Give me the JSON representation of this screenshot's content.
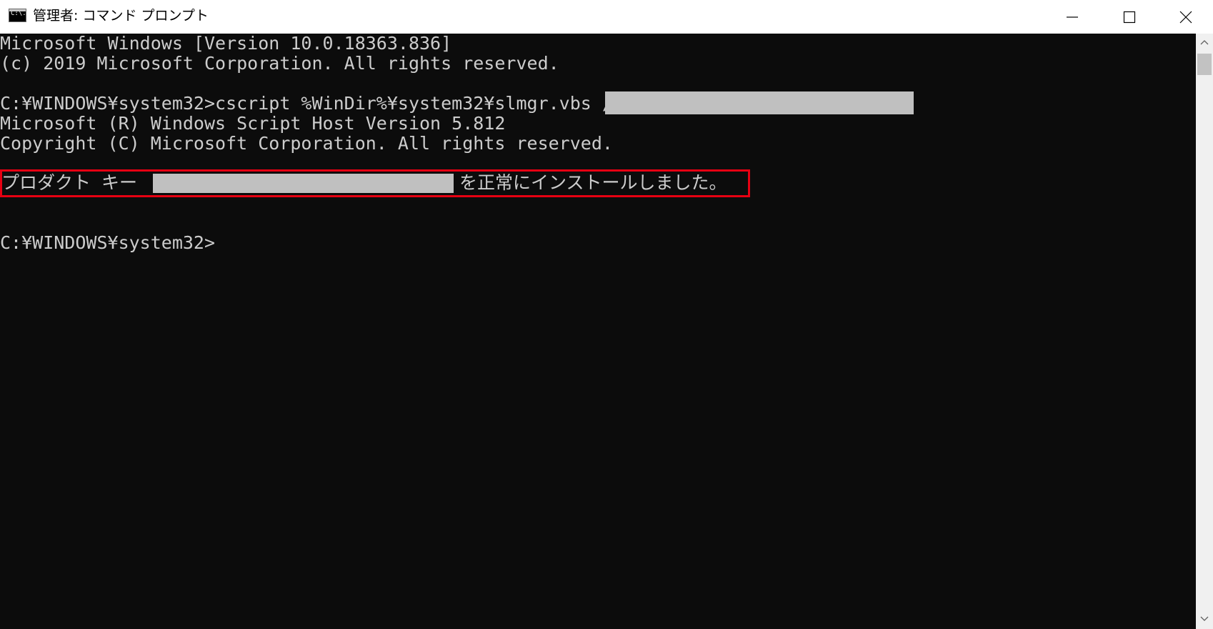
{
  "window": {
    "title": "管理者: コマンド プロンプト",
    "icon_text": "C:\\."
  },
  "controls": {
    "minimize_icon": "minimize-icon",
    "maximize_icon": "maximize-icon",
    "close_icon": "close-icon"
  },
  "console": {
    "lines": [
      "Microsoft Windows [Version 10.0.18363.836]",
      "(c) 2019 Microsoft Corporation. All rights reserved.",
      "C:¥WINDOWS¥system32>cscript %WinDir%¥system32¥slmgr.vbs /ipk",
      "Microsoft (R) Windows Script Host Version 5.812",
      "Copyright (C) Microsoft Corporation. All rights reserved.",
      "プロダクト キー",
      "を正常にインストールしました。",
      "C:¥WINDOWS¥system32>"
    ]
  },
  "colors": {
    "console_background": "#0c0c0c",
    "console_text": "#cccccc",
    "highlight_border": "#e60012",
    "redaction": "#c0c0c0"
  }
}
